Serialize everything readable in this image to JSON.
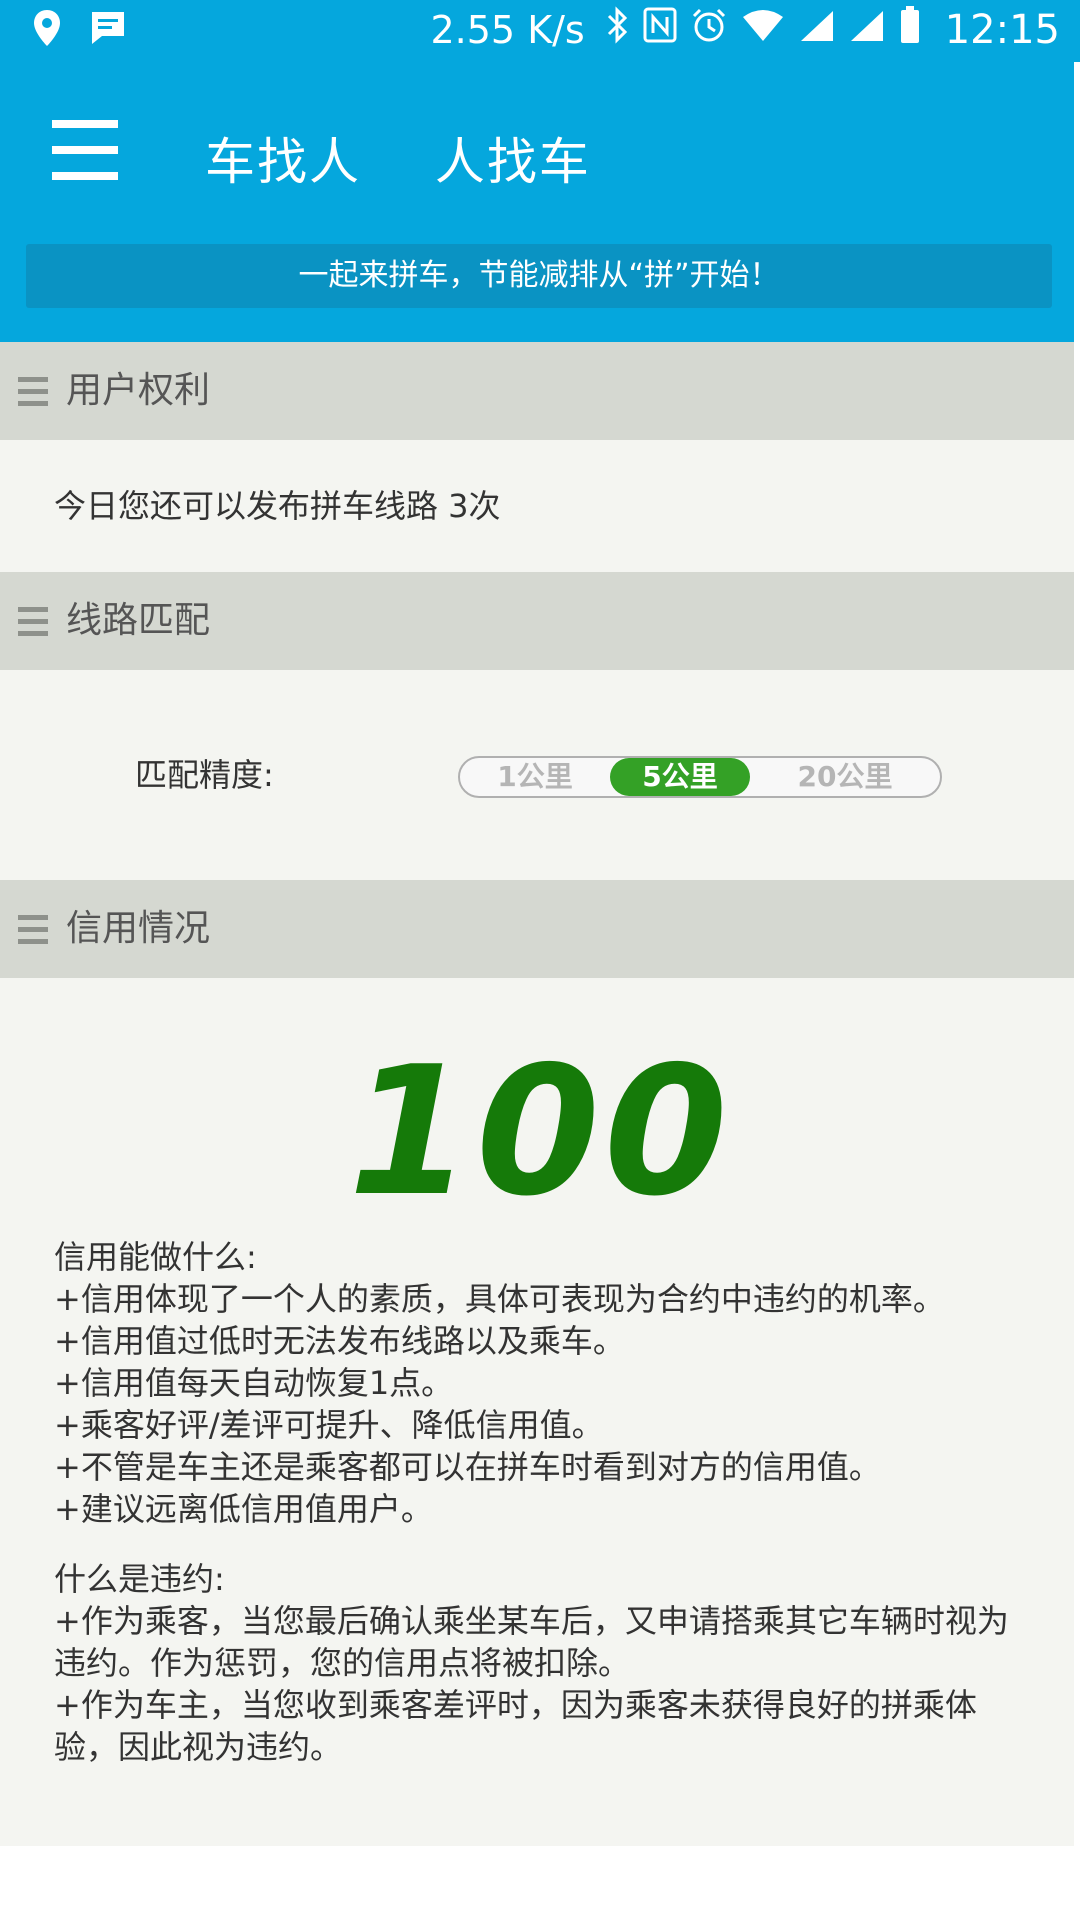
{
  "status_bar": {
    "speed": "2.55 K/s",
    "time": "12:15",
    "icons": [
      "location-icon",
      "message-icon",
      "bluetooth-icon",
      "nfc-icon",
      "alarm-icon",
      "wifi-icon",
      "signal-icon",
      "signal2-icon",
      "battery-icon"
    ]
  },
  "app_bar": {
    "title_1": "车找人",
    "title_2": "人找车",
    "banner": "一起来拼车，节能减排从“拼”开始！"
  },
  "sections": {
    "rights": {
      "title": "用户权利",
      "text": "今日您还可以发布拼车线路 3次"
    },
    "matching": {
      "title": "线路匹配",
      "label": "匹配精度:",
      "options": [
        "1公里",
        "5公里",
        "20公里"
      ],
      "selected": "5公里"
    },
    "credit": {
      "title": "信用情况",
      "score": "100",
      "what_title": "信用能做什么:",
      "what_items": [
        " +信用体现了一个人的素质，具体可表现为合约中违约的机率。",
        " +信用值过低时无法发布线路以及乘车。",
        " +信用值每天自动恢复1点。",
        " +乘客好评/差评可提升、降低信用值。",
        " +不管是车主还是乘客都可以在拼车时看到对方的信用值。",
        " +建议远离低信用值用户。"
      ],
      "breach_title": "什么是违约:",
      "breach_items": [
        " +作为乘客，当您最后确认乘坐某车后，又申请搭乘其它车辆时视为违约。作为惩罚，您的信用点将被扣除。",
        " +作为车主，当您收到乘客差评时，因为乘客未获得良好的拼乘体验，因此视为违约。"
      ]
    }
  },
  "colors": {
    "primary": "#05a7dd",
    "banner": "#0a93c3",
    "section_header": "#d5d8d1",
    "accent_green": "#34a126",
    "score_green": "#157a09"
  }
}
